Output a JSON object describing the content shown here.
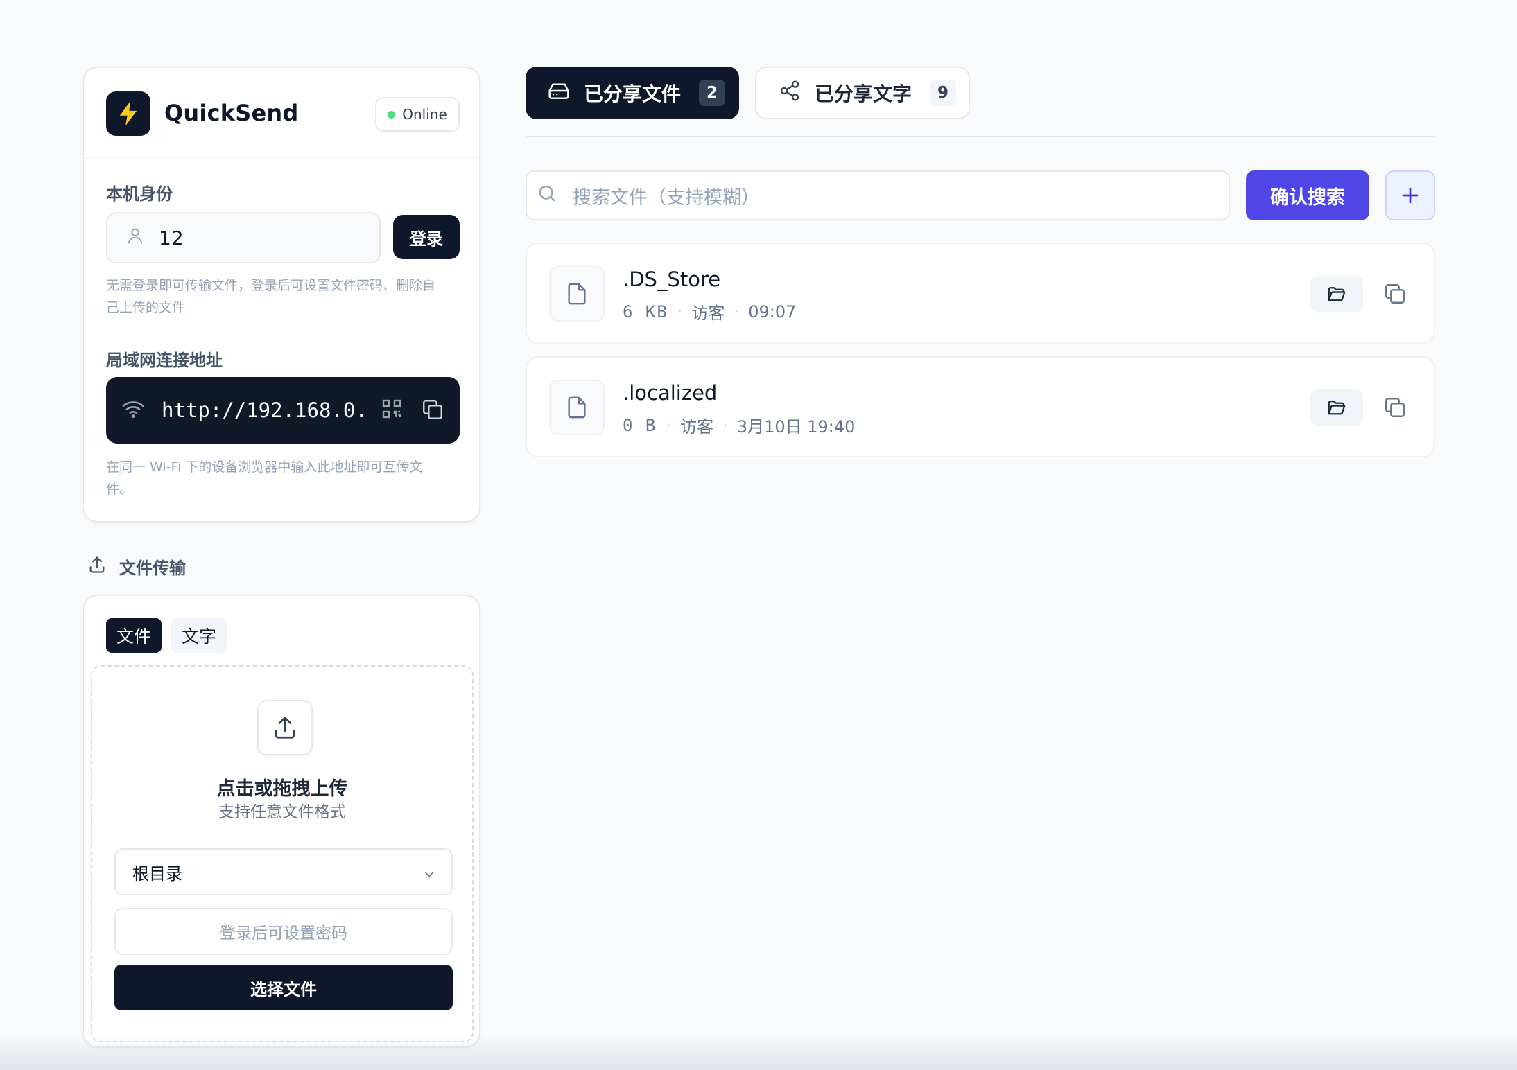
{
  "app": {
    "name": "QuickSend",
    "status": "Online",
    "status_color": "#4ade80",
    "logo_icon": "lightning-icon",
    "settings_icon": "gear-icon"
  },
  "identity": {
    "label": "本机身份",
    "user_value": "12",
    "login_label": "登录",
    "hint_line1": "无需登录即可传输文件，登录后可设置文件密码、删除自",
    "hint_line2": "己上传的文件"
  },
  "lan": {
    "label": "局域网连接地址",
    "url": "http://192.168.0.",
    "hint_line1": "在同一 Wi-Fi 下的设备浏览器中输入此地址即可互传文",
    "hint_line2": "件。"
  },
  "transfer": {
    "title": "文件传输",
    "tabs": [
      {
        "label": "文件",
        "active": true
      },
      {
        "label": "文字",
        "active": false
      }
    ],
    "upload_title": "点击或拖拽上传",
    "upload_sub": "支持任意文件格式",
    "folder_selected": "根目录",
    "password_placeholder": "登录后可设置密码",
    "choose_label": "选择文件"
  },
  "main": {
    "tabs": [
      {
        "label": "已分享文件",
        "count": "2",
        "active": true
      },
      {
        "label": "已分享文字",
        "count": "9",
        "active": false
      }
    ],
    "search_placeholder": "搜索文件（支持模糊）",
    "search_button": "确认搜索",
    "accent_color": "#4f46e5",
    "files": [
      {
        "name": ".DS_Store",
        "size": "6 KB",
        "uploader": "访客",
        "time": "09:07"
      },
      {
        "name": ".localized",
        "size": "0 B",
        "uploader": "访客",
        "time": "3月10日 19:40"
      }
    ]
  }
}
